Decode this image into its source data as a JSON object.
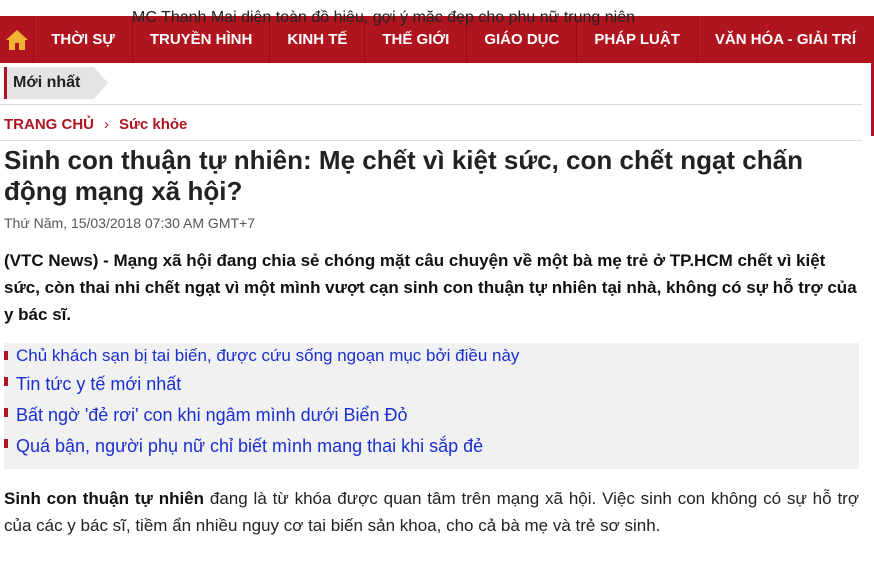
{
  "nav": {
    "items": [
      {
        "label": "THỜI SỰ"
      },
      {
        "label": "TRUYỀN HÌNH"
      },
      {
        "label": "KINH TẾ"
      },
      {
        "label": "THẾ GIỚI"
      },
      {
        "label": "GIÁO DỤC"
      },
      {
        "label": "PHÁP LUẬT"
      },
      {
        "label": "VĂN HÓA - GIẢI TRÍ"
      }
    ],
    "home_icon": "home-icon"
  },
  "latest": {
    "tag": "Mới nhất",
    "headline": "MC Thanh Mai diện toàn đồ hiệu, gợi ý mặc đẹp cho phụ nữ trung niên"
  },
  "breadcrumb": {
    "home": "TRANG CHỦ",
    "separator": "›",
    "category": "Sức khỏe"
  },
  "article": {
    "title": "Sinh con thuận tự nhiên: Mẹ chết vì kiệt sức, con chết ngạt chấn động mạng xã hội?",
    "date": "Thứ Năm, 15/03/2018 07:30 AM GMT+7",
    "lead": "(VTC News) - Mạng xã hội đang chia sẻ chóng mặt câu chuyện về một bà mẹ trẻ ở TP.HCM chết vì kiệt sức, còn thai nhi chết ngạt vì một mình vượt cạn sinh con thuận tự nhiên tại nhà, không có sự hỗ trợ của y bác sĩ.",
    "related": [
      {
        "text": "Chủ khách sạn bị tai biến, được cứu sống ngoạn mục bởi điều này"
      },
      {
        "text": "Tin tức y tế mới nhất"
      },
      {
        "text": "Bất ngờ 'đẻ rơi' con khi ngâm mình dưới Biển Đỏ"
      },
      {
        "text": "Quá bận, người phụ nữ chỉ biết mình mang thai khi sắp đẻ"
      }
    ],
    "body_bold": "Sinh con thuận tự nhiên",
    "body_rest": " đang là từ khóa được quan tâm trên mạng xã hội. Việc sinh con không có sự hỗ trợ của các y bác sĩ, tiềm ẩn nhiều nguy cơ tai biến sản khoa, cho cả bà mẹ và trẻ sơ sinh."
  },
  "colors": {
    "brand": "#b0151f",
    "link": "#1a2fd0"
  }
}
